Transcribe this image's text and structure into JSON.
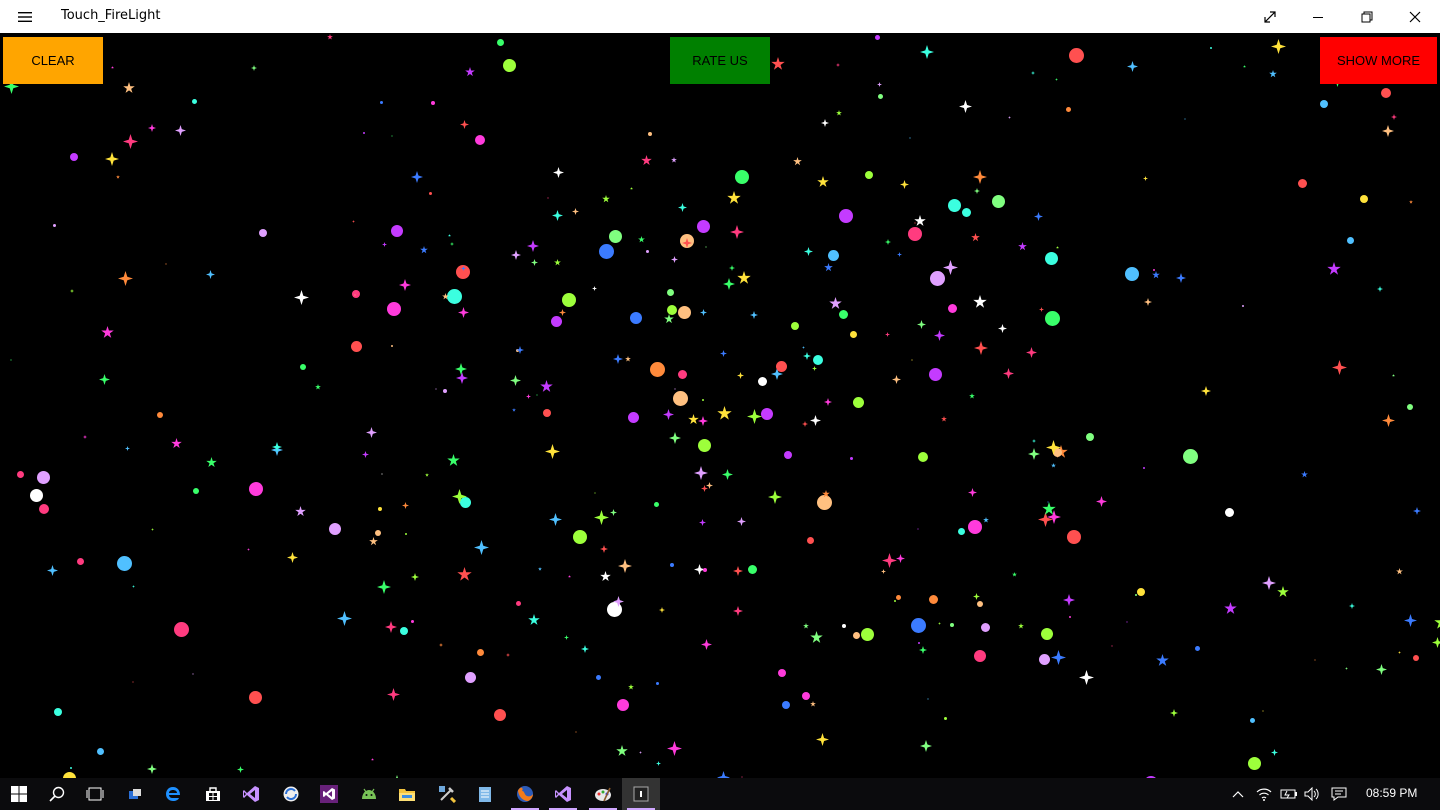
{
  "window": {
    "title": "Touch_FireLight",
    "menu_icon": "hamburger-icon",
    "controls": [
      "fullscreen-icon",
      "minimize-icon",
      "restore-icon",
      "close-icon"
    ]
  },
  "app": {
    "clear_label": "CLEAR",
    "rate_label": "RATE US",
    "more_label": "SHOW MORE",
    "colors": {
      "clear": "#FFA500",
      "rate": "#008000",
      "more": "#FF0000",
      "canvas": "#000000"
    }
  },
  "taskbar": {
    "pinned_icons": [
      "windows-start-icon",
      "search-icon",
      "task-view-icon",
      "settings-tool-icon",
      "edge-icon",
      "store-icon",
      "visual-studio-icon",
      "browser-sync-icon",
      "visual-studio-icon",
      "android-icon",
      "file-explorer-icon",
      "tools-icon",
      "notepad-icon",
      "firefox-icon",
      "visual-studio-icon",
      "paint-icon",
      "app-window-icon"
    ],
    "tray_icons": [
      "chevron-up-icon",
      "wifi-icon",
      "battery-icon",
      "volume-icon",
      "action-center-icon"
    ],
    "clock": "08:59 PM"
  }
}
